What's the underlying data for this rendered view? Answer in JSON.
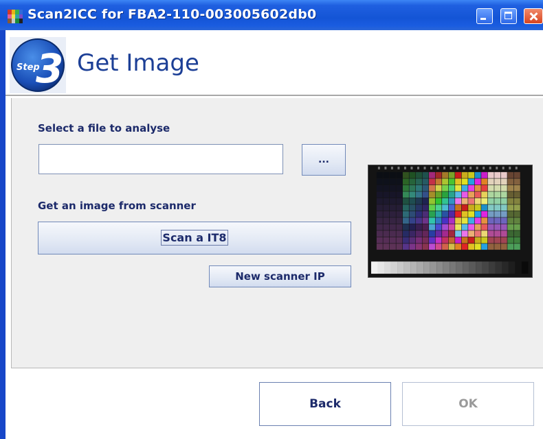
{
  "window": {
    "title": "Scan2ICC for FBA2-110-003005602db0"
  },
  "header": {
    "step_badge_text": "Step",
    "step_number": "3",
    "title": "Get Image"
  },
  "file_section": {
    "label": "Select a file to analyse",
    "file_path_value": "",
    "browse_label": "..."
  },
  "scanner_section": {
    "label": "Get an image from scanner",
    "scan_button_label": "Scan a IT8",
    "new_ip_button_label": "New scanner IP"
  },
  "footer": {
    "back_label": "Back",
    "ok_label": "OK",
    "ok_enabled": false
  },
  "icons": {
    "app_icon": "color-grid-icon",
    "preview": "it8-target-image"
  },
  "colors": {
    "titlebar": "#1455d6",
    "heading": "#1c3f96",
    "label": "#1c2a6a",
    "panel_bg": "#efefef",
    "disabled_text": "#9a9a9a"
  }
}
